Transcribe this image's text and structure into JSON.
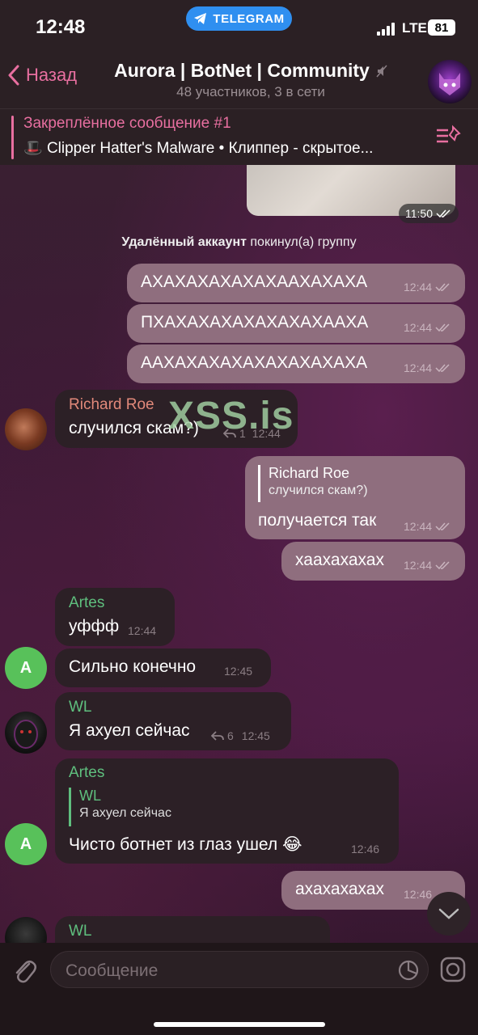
{
  "status_bar": {
    "time": "12:48",
    "app_pill": "TELEGRAM",
    "network": "LTE",
    "battery": "81"
  },
  "header": {
    "back_label": "Назад",
    "title": "Aurora | BotNet | Community",
    "subtitle": "48 участников, 3 в сети"
  },
  "pinned": {
    "title": "Закреплённое сообщение #1",
    "emoji": "🎩",
    "text": "Clipper Hatter's Malware • Клиппер - скрытое..."
  },
  "photo_time": "11:50",
  "service": {
    "actor": "Удалённый аккаунт",
    "action": " покинул(а) группу"
  },
  "watermark": "XSS.is",
  "messages": [
    {
      "text": "АХАХАХАХАХАХААХАХАХА",
      "time": "12:44"
    },
    {
      "text": "ПХАХАХАХАХАХАХАХААХА",
      "time": "12:44"
    },
    {
      "text": "ААХАХАХАХАХАХАХАХАХА",
      "time": "12:44"
    },
    {
      "sender": "Richard Roe",
      "text": "случился скам?)",
      "replies": "1",
      "time": "12:44"
    },
    {
      "reply_sender": "Richard Roe",
      "reply_text": "случился скам?)",
      "text": "получается так",
      "time": "12:44"
    },
    {
      "text": "хаахахахах",
      "time": "12:44"
    },
    {
      "sender": "Artes",
      "text": "уффф",
      "time": "12:44"
    },
    {
      "text": "Сильно конечно",
      "time": "12:45",
      "avatar_letter": "A"
    },
    {
      "sender": "WL",
      "text": "Я ахуел сейчас",
      "replies": "6",
      "time": "12:45"
    },
    {
      "sender": "Artes",
      "reply_sender": "WL",
      "reply_text": "Я ахуел сейчас",
      "text": "Чисто ботнет из глаз ушел 😂",
      "time": "12:46",
      "avatar_letter": "A"
    },
    {
      "text": "ахахахахах",
      "time": "12:46"
    },
    {
      "sender": "WL"
    }
  ],
  "composer": {
    "placeholder": "Сообщение"
  }
}
